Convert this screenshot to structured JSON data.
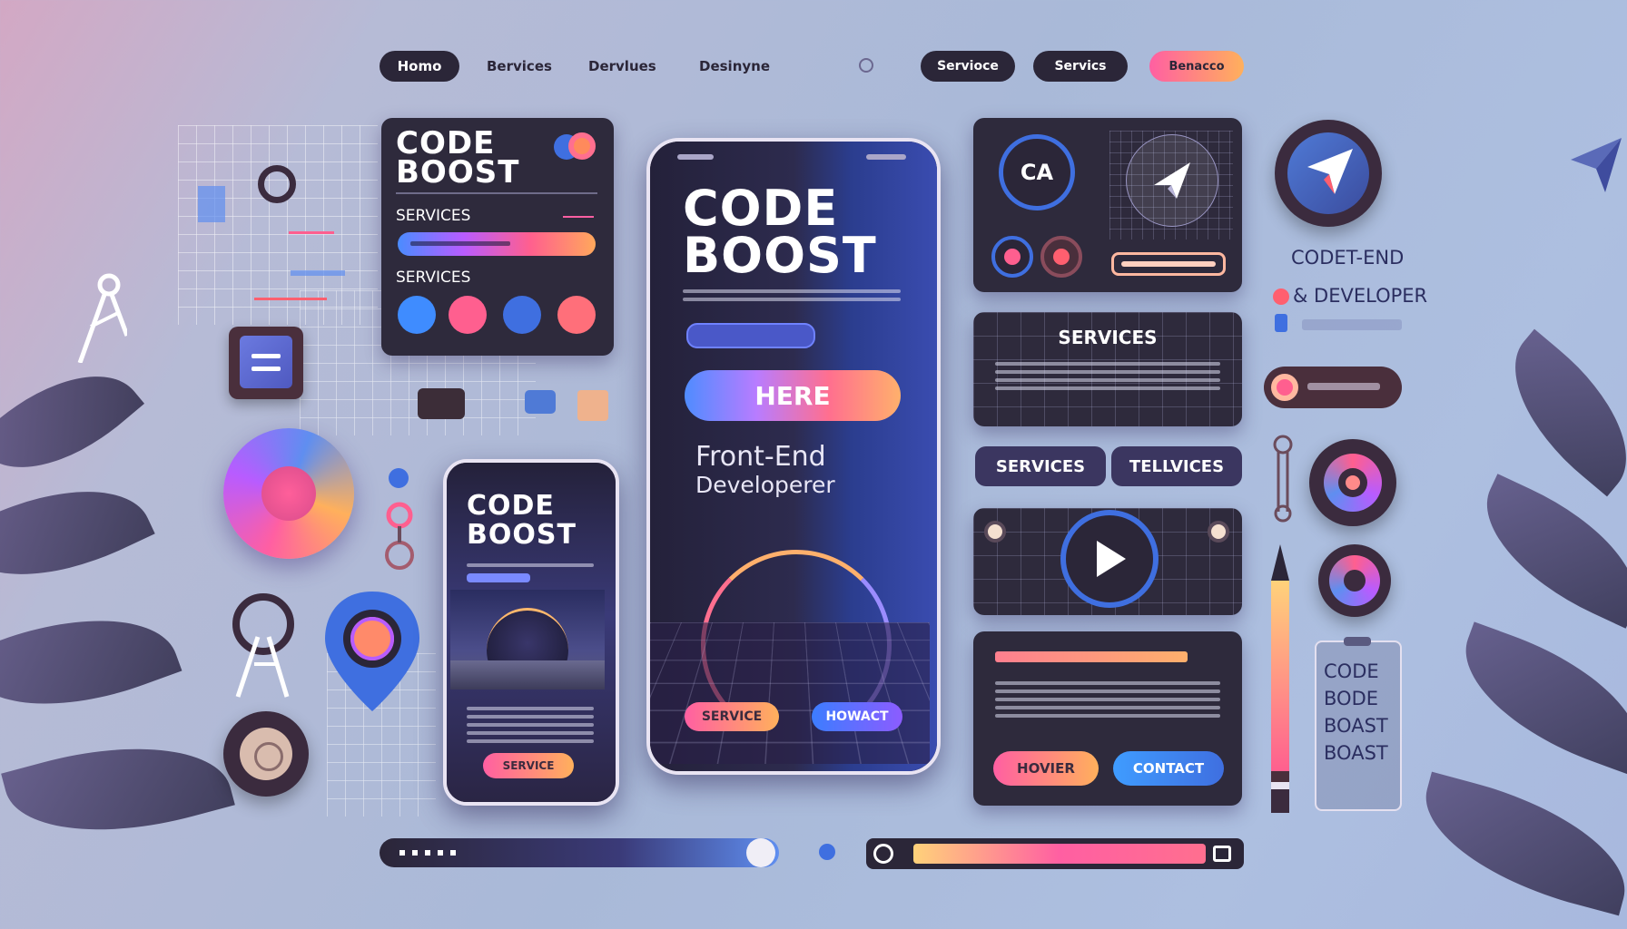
{
  "nav": {
    "left": [
      "Homo",
      "Bervices",
      "Dervlues",
      "Desinyne"
    ],
    "right": [
      "Servioce",
      "Servics",
      "Benacco"
    ]
  },
  "card_left": {
    "title_line1": "CODE",
    "title_line2": "BOOST",
    "label1": "SERVICES",
    "label2": "SERVICES"
  },
  "phone_main": {
    "title_line1": "CODE",
    "title_line2": "BOOST",
    "cta": "HERE",
    "subtitle_line1": "Front-End",
    "subtitle_line2": "Developerer",
    "btn_left": "SERVICE",
    "btn_right": "HOWACT"
  },
  "phone_small": {
    "title_line1": "CODE",
    "title_line2": "BOOST",
    "btn": "SERVICE"
  },
  "right_col": {
    "ca_badge": "CA",
    "services_card_title": "SERVICES",
    "tab1": "SERVICES",
    "tab2": "TELLVICES",
    "hero_card_btn1": "HOVIER",
    "hero_card_btn2": "CONTACT",
    "side_text1": "CODET-END",
    "side_text2": "& DEVELOPER",
    "badge_text_lines": [
      "CODE",
      "BODE",
      "BOAST",
      "BOAST"
    ]
  },
  "colors": {
    "accent_pink": "#ff5fa2",
    "accent_orange": "#ffb05c",
    "accent_blue": "#3c7dff",
    "card_dark": "#2e2a3c"
  }
}
